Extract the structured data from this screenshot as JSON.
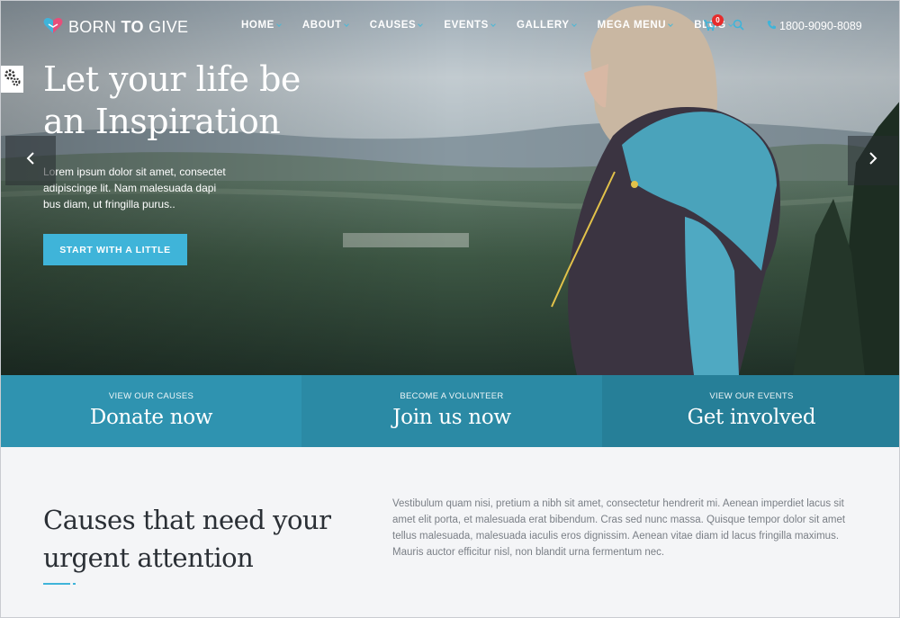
{
  "brand": {
    "name_part1": "BORN",
    "name_part2": "TO",
    "name_part3": "GIVE"
  },
  "nav": {
    "items": [
      {
        "label": "HOME",
        "dropdown": true
      },
      {
        "label": "ABOUT",
        "dropdown": true
      },
      {
        "label": "CAUSES",
        "dropdown": true
      },
      {
        "label": "EVENTS",
        "dropdown": true
      },
      {
        "label": "GALLERY",
        "dropdown": true
      },
      {
        "label": "MEGA MENU",
        "dropdown": true
      },
      {
        "label": "BLOG",
        "dropdown": true
      }
    ],
    "cart_count": "0",
    "phone": "1800-9090-8089"
  },
  "hero": {
    "headline_line1": "Let your life be",
    "headline_line2": "an Inspiration",
    "lead": "Lorem ipsum dolor sit amet, consectet adipiscinge lit. Nam malesuada dapi bus diam, ut fringilla purus..",
    "cta_label": "START WITH A LITTLE"
  },
  "strip": [
    {
      "small": "VIEW OUR CAUSES",
      "big": "Donate now",
      "color": "#2f93b0"
    },
    {
      "small": "BECOME A VOLUNTEER",
      "big": "Join us now",
      "color": "#2b8aa5"
    },
    {
      "small": "VIEW OUR EVENTS",
      "big": "Get involved",
      "color": "#267f98"
    }
  ],
  "causes": {
    "title_line1": "Causes that need your",
    "title_line2": "urgent attention",
    "text": "Vestibulum quam nisi, pretium a nibh sit amet, consectetur hendrerit mi. Aenean imperdiet lacus sit amet elit porta, et malesuada erat bibendum. Cras sed nunc massa. Quisque tempor dolor sit amet tellus malesuada, malesuada iaculis eros dignissim. Aenean vitae diam id lacus fringilla maximus. Mauris auctor efficitur nisl, non blandit urna fermentum nec."
  },
  "colors": {
    "accent": "#3fb4d9",
    "heading": "#2a2f35",
    "body_text": "#7a7f86",
    "section_bg": "#f4f5f7"
  },
  "icons": {
    "logo": "heart-hands-icon",
    "cart": "cart-icon",
    "search": "search-icon",
    "phone": "phone-icon",
    "settings": "gear-icon",
    "prev": "chevron-left-icon",
    "next": "chevron-right-icon"
  }
}
